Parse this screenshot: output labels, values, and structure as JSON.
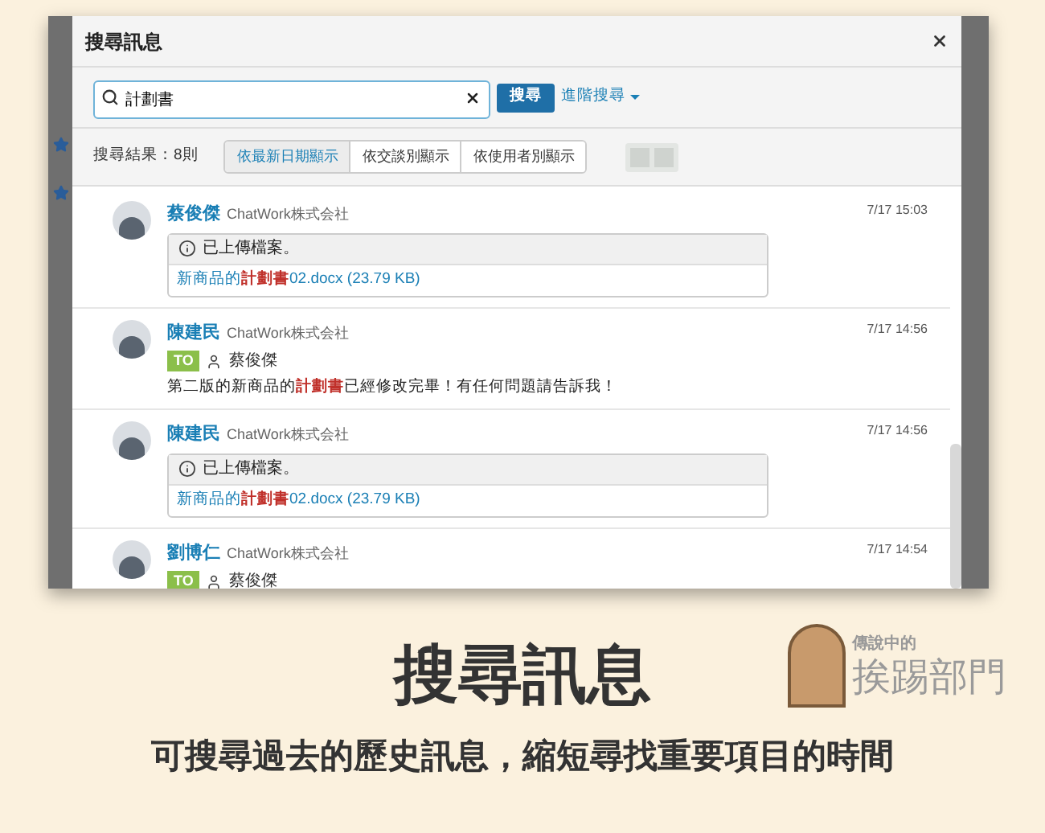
{
  "dialog": {
    "title": "搜尋訊息"
  },
  "search": {
    "value": "計劃書",
    "button": "搜尋",
    "advanced": "進階搜尋"
  },
  "results": {
    "count": "搜尋結果：8則"
  },
  "tabs": [
    {
      "label": "依最新日期顯示",
      "selected": true
    },
    {
      "label": "依交談別顯示",
      "selected": false
    },
    {
      "label": "依使用者別顯示",
      "selected": false
    }
  ],
  "messages": [
    {
      "kind": "file",
      "name": "蔡俊傑",
      "company": "ChatWork株式会社",
      "time": "7/17 15:03",
      "notice": "已上傳檔案。",
      "file": "新商品的**計劃書**02.docx (23.79 KB)"
    },
    {
      "kind": "text",
      "name": "陳建民",
      "company": "ChatWork株式会社",
      "time": "7/17 14:56",
      "to_badge": "TO",
      "to": "蔡俊傑",
      "text": "第二版的新商品的**計劃書**已經修改完畢！有任何問題請告訴我！"
    },
    {
      "kind": "file",
      "name": "陳建民",
      "company": "ChatWork株式会社",
      "time": "7/17 14:56",
      "notice": "已上傳檔案。",
      "file": "新商品的**計劃書**02.docx (23.79 KB)"
    },
    {
      "kind": "to",
      "name": "劉博仁",
      "company": "ChatWork株式会社",
      "time": "7/17 14:54",
      "to_badge": "TO",
      "to": "蔡俊傑"
    }
  ],
  "footer": {
    "heading": "搜尋訊息",
    "subtitle": "可搜尋過去的歷史訊息，縮短尋找重要項目的時間",
    "logo_small": "傳說中的",
    "logo_big": "挨踢部門"
  }
}
